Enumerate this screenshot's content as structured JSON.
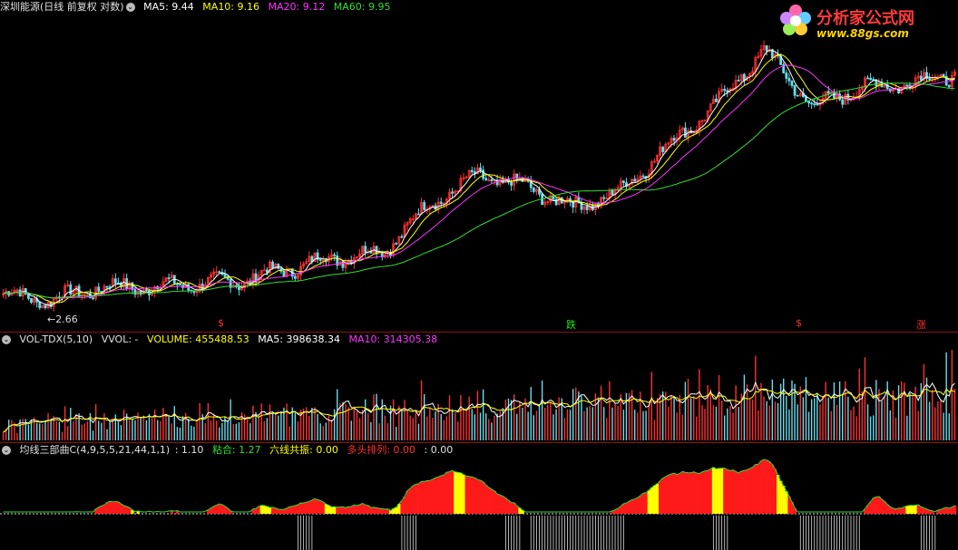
{
  "main_header": {
    "title": "深圳能源(日线 前复权 对数)",
    "ma5": "MA5: 9.44",
    "ma10": "MA10: 9.16",
    "ma20": "MA20: 9.12",
    "ma60": "MA60: 9.95"
  },
  "vol_header": {
    "name": "VOL-TDX(5,10)",
    "vvol": "VVOL: -",
    "volume": "VOLUME: 455488.53",
    "ma5": "MA5: 398638.34",
    "ma10": "MA10: 314305.38"
  },
  "ind_header": {
    "name": "均线三部曲C(4,9,5,5,21,44,1,1)",
    "v1": ": 1.10",
    "stick": "粘合: 1.27",
    "resonance": "六线共振: 0.00",
    "bull": "多头排列: 0.00",
    "v5": ": 0.00"
  },
  "price_low_label": "2.66",
  "signals": [
    {
      "text": "$",
      "color": "#ff3030"
    },
    {
      "text": "跌",
      "color": "#19e619"
    },
    {
      "text": "$",
      "color": "#ff3030"
    },
    {
      "text": "涨",
      "color": "#ff3030"
    }
  ],
  "watermark": {
    "title": "分析家公式网",
    "url": "www.88gs.com"
  },
  "colors": {
    "ma5": "#ffffff",
    "ma10": "#ffff00",
    "ma20": "#ff33ff",
    "ma60": "#33dd33",
    "up": "#ff3030",
    "down": "#66ddee",
    "bg": "#000000",
    "grid": "#8b1414"
  },
  "chart_data": [
    {
      "type": "line",
      "title": "深圳能源(日线 前复权 对数)",
      "series_names": [
        "MA5",
        "MA10",
        "MA20",
        "MA60"
      ],
      "last_values": [
        9.44,
        9.16,
        9.12,
        9.95
      ],
      "annotations": [
        "2.66"
      ],
      "x": [
        0,
        5,
        10,
        15,
        20,
        25,
        30,
        35,
        40,
        45,
        50,
        55,
        60,
        65,
        70,
        75,
        80,
        85,
        90,
        95,
        100
      ],
      "close": [
        2.9,
        2.8,
        3.0,
        3.0,
        3.05,
        3.1,
        3.3,
        3.5,
        3.6,
        4.6,
        5.3,
        5.0,
        4.5,
        4.9,
        6.2,
        7.6,
        10.0,
        7.5,
        8.3,
        8.5,
        8.9
      ]
    },
    {
      "type": "bar",
      "title": "VOL-TDX(5,10)",
      "series_names": [
        "VOLUME",
        "MA5",
        "MA10"
      ],
      "last_values": [
        455488.53,
        398638.34,
        314305.38
      ]
    },
    {
      "type": "area",
      "title": "均线三部曲C(4,9,5,5,21,44,1,1)",
      "last_values": [
        1.1,
        1.27,
        0.0,
        0.0,
        0.0
      ]
    }
  ]
}
